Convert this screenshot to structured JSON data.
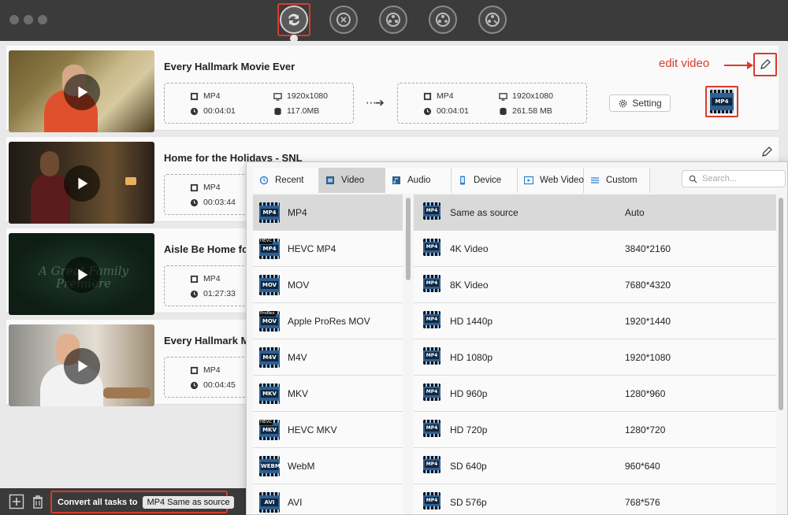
{
  "toolbar": {
    "buttons": [
      {
        "name": "convert-icon"
      },
      {
        "name": "compress-icon"
      },
      {
        "name": "dvd-icon"
      },
      {
        "name": "merge-icon"
      },
      {
        "name": "toolbox-icon"
      }
    ]
  },
  "annotation": {
    "edit_label": "edit video"
  },
  "videos": [
    {
      "title": "Every Hallmark Movie Ever",
      "src_format": "MP4",
      "src_resolution": "1920x1080",
      "src_duration": "00:04:01",
      "src_size": "117.0MB",
      "out_format": "MP4",
      "out_resolution": "1920x1080",
      "out_duration": "00:04:01",
      "out_size": "261.58 MB",
      "setting_label": "Setting",
      "badge": "MP4"
    },
    {
      "title": "Home for the Holidays - SNL",
      "src_format": "MP4",
      "src_duration": "00:03:44"
    },
    {
      "title": "Aisle Be Home fo",
      "src_format": "MP4",
      "src_duration": "01:27:33",
      "thumb_text": "A Great Family Premiere"
    },
    {
      "title": "Every Hallmark M",
      "src_format": "MP4",
      "src_duration": "00:04:45"
    }
  ],
  "bottom": {
    "convert_label": "Convert all tasks to",
    "convert_value": "MP4 Same as source"
  },
  "popup": {
    "tabs": [
      {
        "label": "Recent",
        "icon": "clock-icon"
      },
      {
        "label": "Video",
        "icon": "film-icon"
      },
      {
        "label": "Audio",
        "icon": "audio-icon"
      },
      {
        "label": "Device",
        "icon": "phone-icon"
      },
      {
        "label": "Web Video",
        "icon": "web-video-icon"
      },
      {
        "label": "Custom",
        "icon": "list-icon"
      }
    ],
    "search_placeholder": "Search...",
    "formats": [
      {
        "label": "MP4",
        "badge": "MP4"
      },
      {
        "label": "HEVC MP4",
        "badge": "MP4",
        "sup": "HEVC"
      },
      {
        "label": "MOV",
        "badge": "MOV"
      },
      {
        "label": "Apple ProRes MOV",
        "badge": "MOV",
        "sup": "ProRes"
      },
      {
        "label": "M4V",
        "badge": "M4V"
      },
      {
        "label": "MKV",
        "badge": "MKV"
      },
      {
        "label": "HEVC MKV",
        "badge": "MKV",
        "sup": "HEVC"
      },
      {
        "label": "WebM",
        "badge": "WEBM"
      },
      {
        "label": "AVI",
        "badge": "AVI"
      }
    ],
    "qualities": [
      {
        "name": "Same as source",
        "res": "Auto"
      },
      {
        "name": "4K Video",
        "res": "3840*2160"
      },
      {
        "name": "8K Video",
        "res": "7680*4320"
      },
      {
        "name": "HD 1440p",
        "res": "1920*1440"
      },
      {
        "name": "HD 1080p",
        "res": "1920*1080"
      },
      {
        "name": "HD 960p",
        "res": "1280*960"
      },
      {
        "name": "HD 720p",
        "res": "1280*720"
      },
      {
        "name": "SD 640p",
        "res": "960*640"
      },
      {
        "name": "SD 576p",
        "res": "768*576"
      }
    ],
    "quality_badge": "MP4"
  }
}
